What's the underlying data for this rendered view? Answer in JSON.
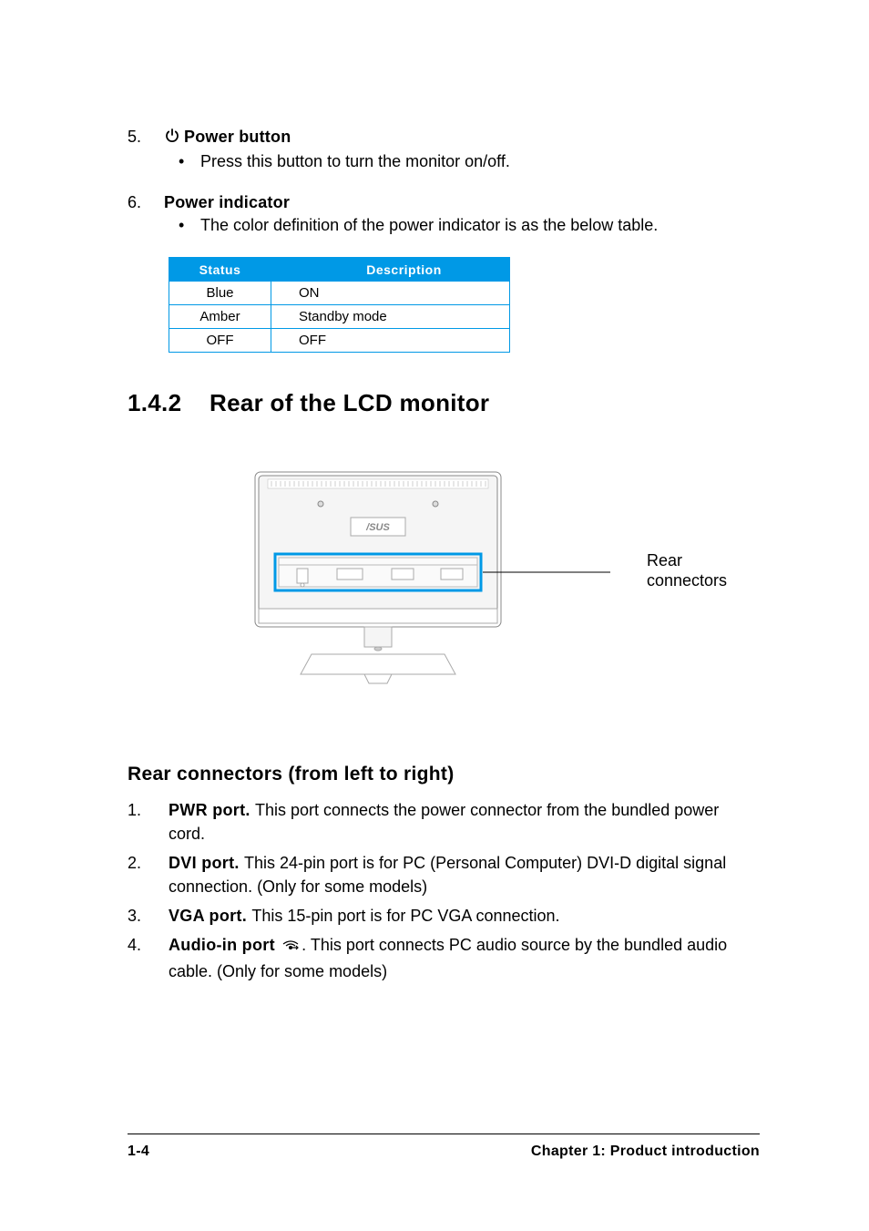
{
  "items": {
    "item5": {
      "num": "5.",
      "title": "Power button",
      "bullet": "Press this button to turn the monitor on/off."
    },
    "item6": {
      "num": "6.",
      "title": "Power indicator",
      "bullet": "The color definition of the power indicator is as the below table."
    }
  },
  "table": {
    "head": {
      "c1": "Status",
      "c2": "Description"
    },
    "rows": [
      {
        "c1": "Blue",
        "c2": "ON"
      },
      {
        "c1": "Amber",
        "c2": "Standby mode"
      },
      {
        "c1": "OFF",
        "c2": "OFF"
      }
    ]
  },
  "section": {
    "num": "1.4.2",
    "title": "Rear of the LCD monitor"
  },
  "callout": {
    "l1": "Rear",
    "l2": "connectors"
  },
  "figure": {
    "label": "/SUS"
  },
  "subheading": "Rear connectors (from left to right)",
  "connectors": [
    {
      "num": "1.",
      "lead": "PWR port. ",
      "rest": "This port connects the power connector from the bundled power cord."
    },
    {
      "num": "2.",
      "lead": "DVI port. ",
      "rest": "This 24-pin port is for PC (Personal Computer) DVI-D digital signal connection. (Only for some models)"
    },
    {
      "num": "3.",
      "lead": "VGA port. ",
      "rest": "This 15-pin port is for PC VGA connection."
    },
    {
      "num": "4.",
      "lead": "Audio-in port ",
      "rest": ". This port connects PC audio source by the bundled audio cable. (Only for some models)"
    }
  ],
  "footer": {
    "left": "1-4",
    "right": "Chapter 1: Product introduction"
  },
  "chart_data": {
    "type": "table",
    "title": "Power indicator status",
    "columns": [
      "Status",
      "Description"
    ],
    "rows": [
      [
        "Blue",
        "ON"
      ],
      [
        "Amber",
        "Standby mode"
      ],
      [
        "OFF",
        "OFF"
      ]
    ]
  }
}
